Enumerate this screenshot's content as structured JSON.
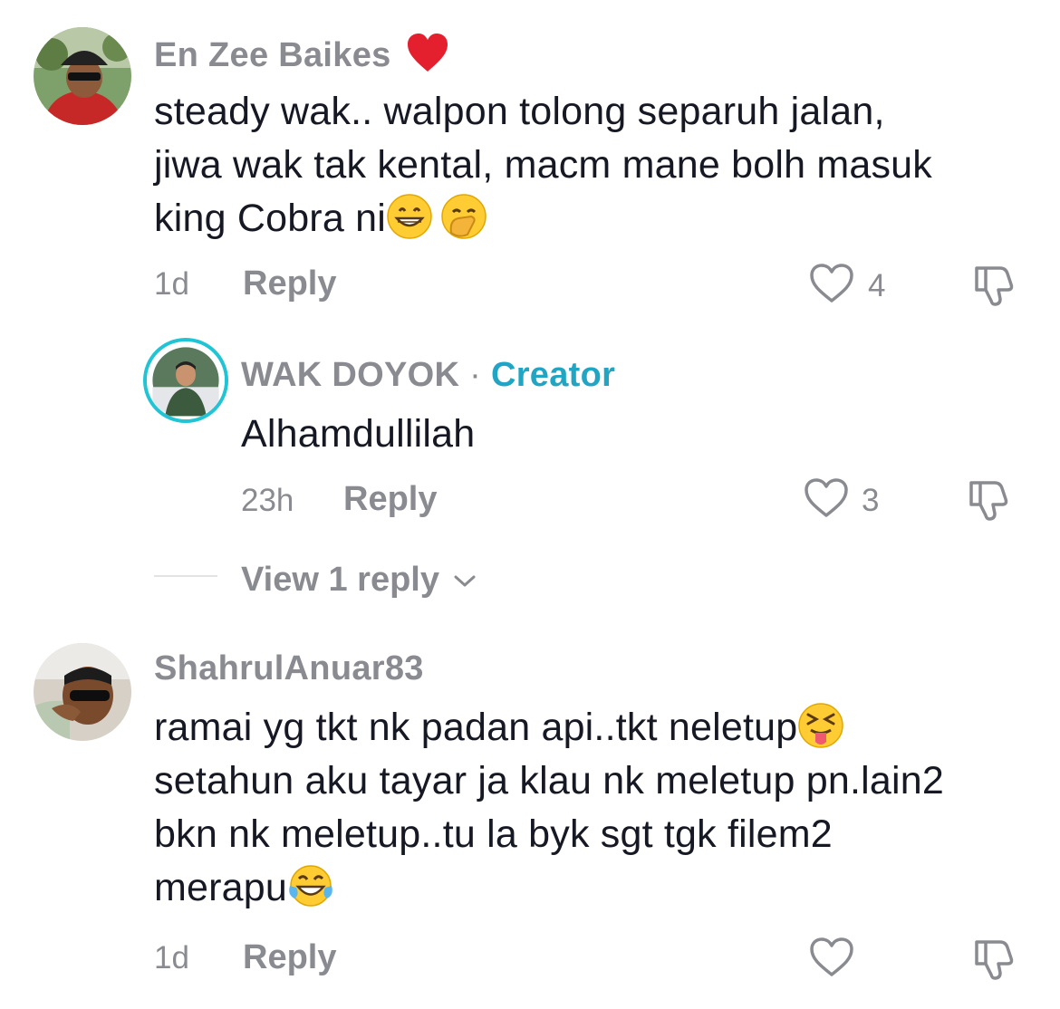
{
  "comments": [
    {
      "username": "En Zee Baikes",
      "badge_icon": "red-heart-icon",
      "lines": [
        "steady wak.. walpon tolong separuh jalan,",
        "jiwa wak tak kental, macm mane bolh masuk",
        "king Cobra ni"
      ],
      "emojis": [
        "grinning-face-emoji",
        "face-with-hand-over-mouth-emoji"
      ],
      "time": "1d",
      "reply_label": "Reply",
      "likes": "4"
    },
    {
      "username": "WAK DOYOK",
      "separator": "·",
      "role_label": "Creator",
      "lines": [
        "Alhamdullilah"
      ],
      "time": "23h",
      "reply_label": "Reply",
      "likes": "3"
    },
    {
      "username": "ShahrulAnuar83",
      "lines": [
        "ramai yg tkt nk padan api..tkt neletup",
        "setahun aku tayar ja klau nk meletup pn.lain2",
        "bkn nk meletup..tu la byk sgt tgk filem2",
        "merapu"
      ],
      "emojis": [
        "squinting-face-with-tongue-emoji",
        "face-with-tears-of-joy-emoji"
      ],
      "time": "1d",
      "reply_label": "Reply",
      "likes": ""
    }
  ],
  "view_replies_label": "View 1 reply",
  "colors": {
    "text": "#161823",
    "muted": "#8a8b91",
    "creator": "#20a5c4"
  }
}
